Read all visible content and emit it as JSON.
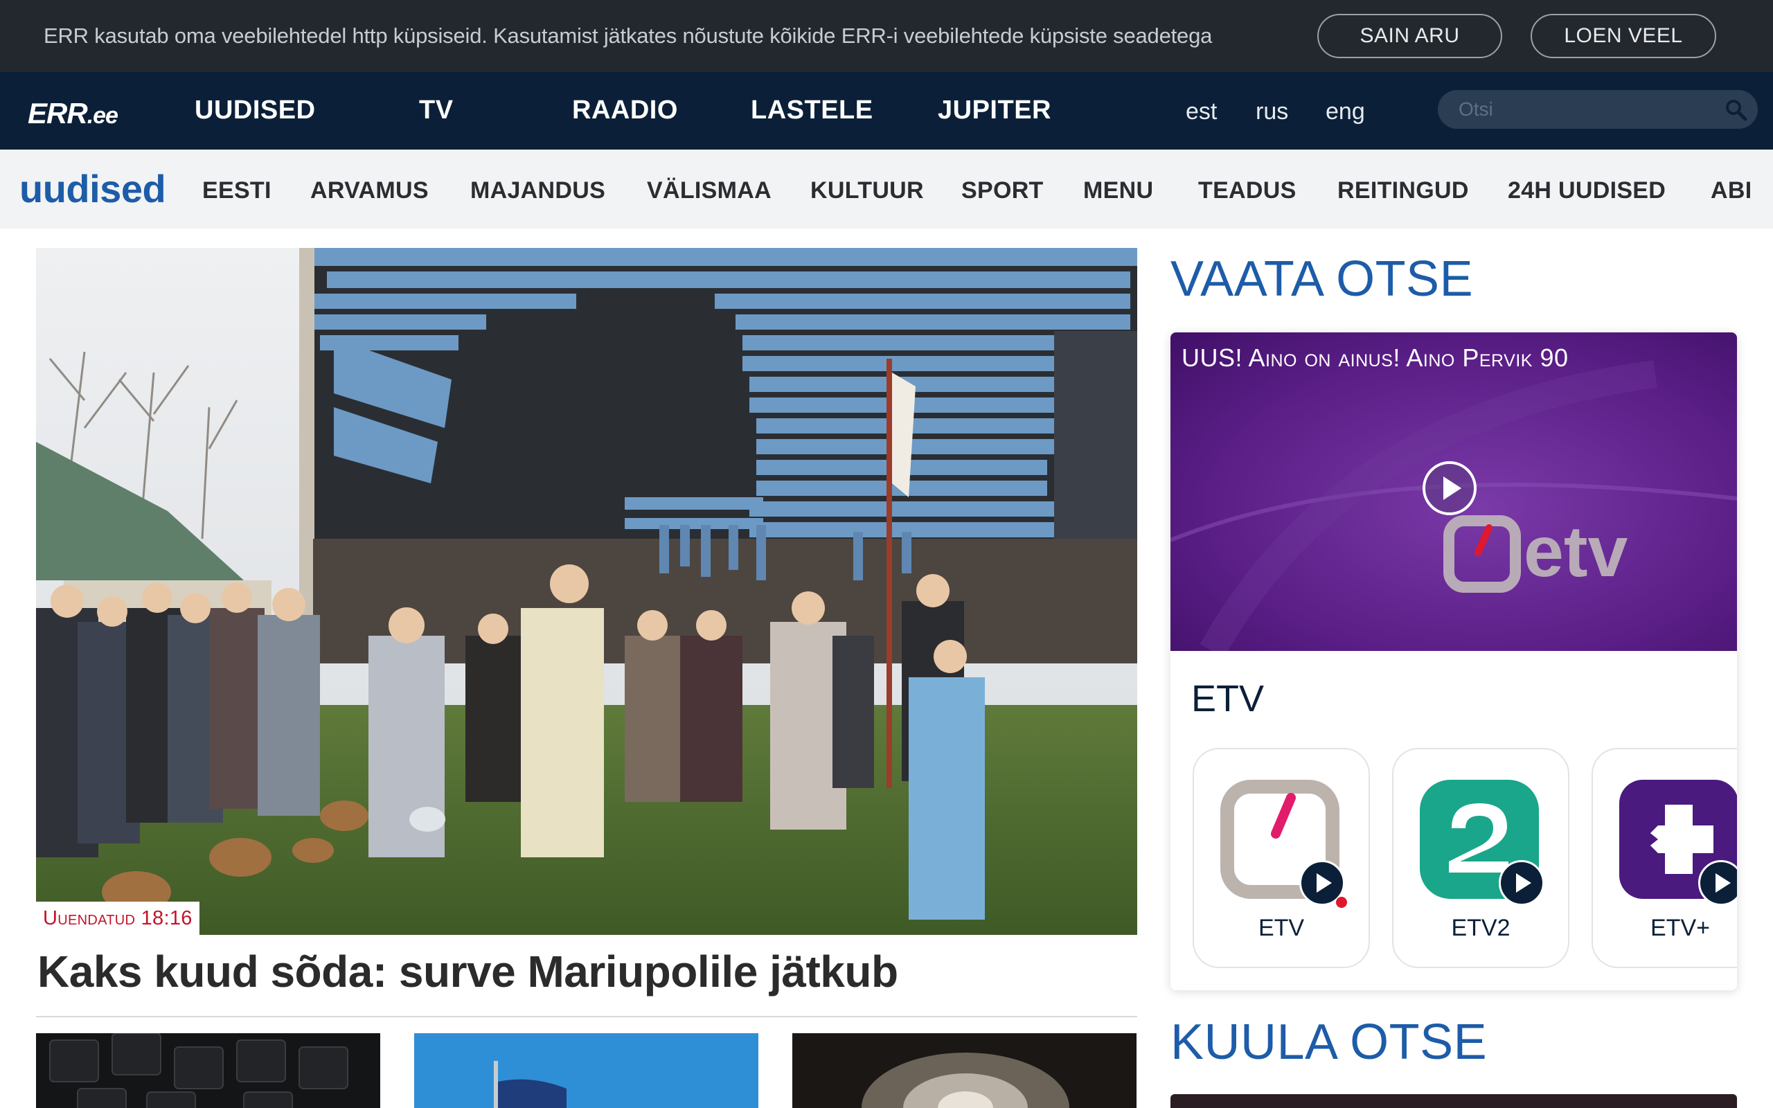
{
  "cookie_bar": {
    "message": "ERR kasutab oma veebilehtedel http küpsiseid. Kasutamist jätkates nõustute kõikide ERR-i veebilehtede küpsiste seadetega",
    "accept_label": "SAIN ARU",
    "more_label": "LOEN VEEL"
  },
  "main_nav": {
    "logo_text": "ERR",
    "logo_suffix": ".ee",
    "items": [
      "UUDISED",
      "TV",
      "RAADIO",
      "LASTELE",
      "JUPITER"
    ],
    "languages": [
      "est",
      "rus",
      "eng"
    ],
    "search_placeholder": "Otsi"
  },
  "sub_nav": {
    "brand": "uudised",
    "items": [
      "EESTI",
      "ARVAMUS",
      "MAJANDUS",
      "VÄLISMAA",
      "KULTUUR",
      "SPORT",
      "MENU",
      "TEADUS",
      "REITINGUD",
      "24H UUDISED",
      "ABI"
    ]
  },
  "hero": {
    "badge": "Uuendatud 18:16",
    "title": "Kaks kuud sõda: surve Mariupolile jätkub"
  },
  "live": {
    "watch_title": "VAATA OTSE",
    "caption": "UUS! Aino on ainus! Aino Pervik 90",
    "player_logo": "etv",
    "channel_group": "ETV",
    "channels": [
      {
        "label": "ETV"
      },
      {
        "label": "ETV2"
      },
      {
        "label": "ETV+"
      }
    ],
    "listen_title": "KUULA OTSE"
  },
  "colors": {
    "dark_nav": "#0b2038",
    "cookie_bg": "#23282f",
    "brand_blue": "#1d5ca8",
    "badge_red": "#c2142a",
    "etv2_green": "#1aa68a",
    "etvplus_purple": "#4a1a7e",
    "live_dot": "#e0182d"
  }
}
